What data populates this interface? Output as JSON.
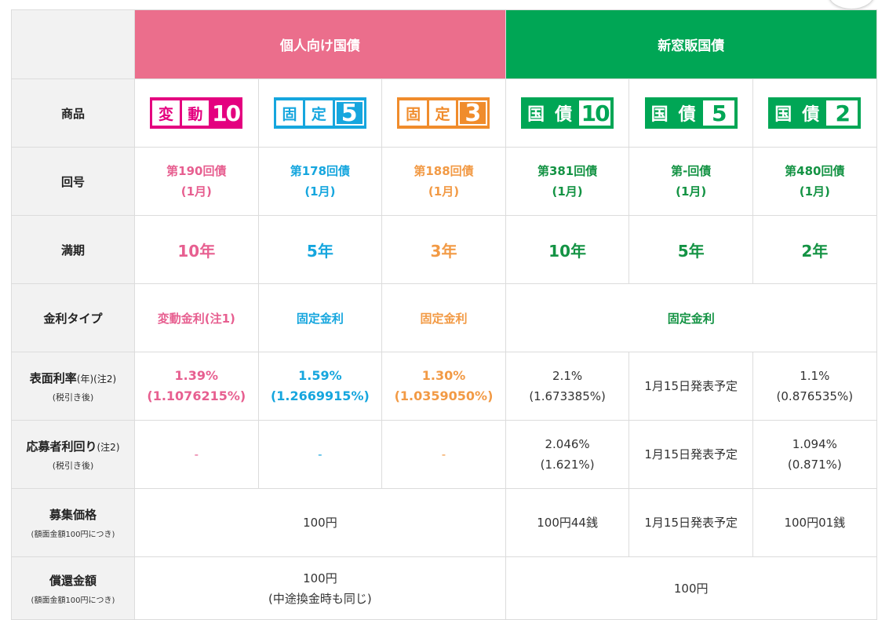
{
  "groups": {
    "retail": "個人向け国債",
    "new": "新窓販国債"
  },
  "labels": {
    "product": "商品",
    "round": "回号",
    "maturity": "満期",
    "rate_type": "金利タイプ",
    "coupon_main": "表面利率",
    "coupon_sub": "(年)(注2)",
    "coupon_note": "(税引き後)",
    "yield_main": "応募者利回り",
    "yield_sub": "(注2)",
    "yield_note": "(税引き後)",
    "price_main": "募集価格",
    "price_note": "(額面金額100円につき)",
    "redeem_main": "償還金額",
    "redeem_note": "(額面金額100円につき)"
  },
  "logos": [
    {
      "chars": [
        "変",
        "動"
      ],
      "num": "10",
      "icon": "hendou10-logo"
    },
    {
      "chars": [
        "固",
        "定"
      ],
      "num": "5",
      "icon": "kotei5-logo"
    },
    {
      "chars": [
        "固",
        "定"
      ],
      "num": "3",
      "icon": "kotei3-logo"
    },
    {
      "chars": [
        "国",
        "債"
      ],
      "num": "10",
      "icon": "kokusai10-logo"
    },
    {
      "chars": [
        "国",
        "債"
      ],
      "num": "5",
      "icon": "kokusai5-logo"
    },
    {
      "chars": [
        "国",
        "債"
      ],
      "num": "2",
      "icon": "kokusai2-logo"
    }
  ],
  "rounds": [
    {
      "line1": "第190回債",
      "line2": "(1月)"
    },
    {
      "line1": "第178回債",
      "line2": "(1月)"
    },
    {
      "line1": "第188回債",
      "line2": "(1月)"
    },
    {
      "line1": "第381回債",
      "line2": "(1月)"
    },
    {
      "line1": "第-回債",
      "line2": "(1月)"
    },
    {
      "line1": "第480回債",
      "line2": "(1月)"
    }
  ],
  "maturity": [
    "10年",
    "5年",
    "3年",
    "10年",
    "5年",
    "2年"
  ],
  "rate_type": {
    "hendou10": "変動金利(注1)",
    "kotei5": "固定金利",
    "kotei3": "固定金利",
    "new": "固定金利"
  },
  "coupon": [
    {
      "line1": "1.39%",
      "line2": "(1.1076215%)"
    },
    {
      "line1": "1.59%",
      "line2": "(1.2669915%)"
    },
    {
      "line1": "1.30%",
      "line2": "(1.0359050%)"
    },
    {
      "line1": "2.1%",
      "line2": "(1.673385%)"
    },
    {
      "line1": "1月15日発表予定"
    },
    {
      "line1": "1.1%",
      "line2": "(0.876535%)"
    }
  ],
  "yield": [
    {
      "line1": "-"
    },
    {
      "line1": "-"
    },
    {
      "line1": "-"
    },
    {
      "line1": "2.046%",
      "line2": "(1.621%)"
    },
    {
      "line1": "1月15日発表予定"
    },
    {
      "line1": "1.094%",
      "line2": "(0.871%)"
    }
  ],
  "price": {
    "retail": "100円",
    "kokusai10": "100円44銭",
    "kokusai5": "1月15日発表予定",
    "kokusai2": "100円01銭"
  },
  "redeem": {
    "retail_line1": "100円",
    "retail_line2": "(中途換金時も同じ)",
    "new": "100円"
  },
  "colors": {
    "pink_header": "#eb6e8c",
    "green_header": "#00a655",
    "pink": "#e75f90",
    "blue": "#16a6de",
    "orange": "#f29a45",
    "green": "#149344"
  }
}
